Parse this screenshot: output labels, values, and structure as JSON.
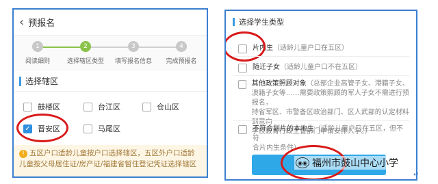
{
  "left_panel": {
    "back_glyph": "‹",
    "title": "预报名",
    "steps": [
      {
        "num": "1",
        "label": "阅读细则"
      },
      {
        "num": "2",
        "label": "选择辖区类型"
      },
      {
        "num": "3",
        "label": "填写报名信息"
      },
      {
        "num": "4",
        "label": "完成预报名"
      }
    ],
    "section_title": "选择辖区",
    "districts": [
      {
        "label": "鼓楼区",
        "checked": false
      },
      {
        "label": "台江区",
        "checked": false
      },
      {
        "label": "仓山区",
        "checked": false
      },
      {
        "label": "晋安区",
        "checked": true
      },
      {
        "label": "马尾区",
        "checked": false
      }
    ],
    "notice_line1": "五区户口适龄儿童按户口选择辖区，五区外户口适龄",
    "notice_line2": "儿童按父母居住证/房产证/福建省暂住登记凭证选择辖区"
  },
  "right_panel": {
    "section_title": "选择学生类型",
    "options": [
      {
        "label": "片内生",
        "note": "（适龄儿童户口在五区）"
      },
      {
        "label": "随迁子女",
        "note": "（适龄儿童户口不在五区）"
      },
      {
        "label": "其他政策照顾对象",
        "note": "（总部企业高管子女、港籍子女、",
        "line2": "澳籍子女等……需要政策照顾的军人子女不需进行预报名，",
        "line3": "持省军区、市警备区政治部门、区人武部的认定材料到意向",
        "line4": "学校教育行政主管部门申请安排入学。）"
      },
      {
        "label": "不符合划片的本地生",
        "note": "（适龄儿童户口在五区，但不符",
        "line2": "合片内生条件）"
      }
    ]
  },
  "watermark": "福州市鼓山中心小学",
  "colors": {
    "accent": "#3a7fd0",
    "check": "#2f8fe0",
    "step_active": "#8bc34a",
    "highlight": "#d91a1a",
    "submit": "#2fa8e8"
  }
}
